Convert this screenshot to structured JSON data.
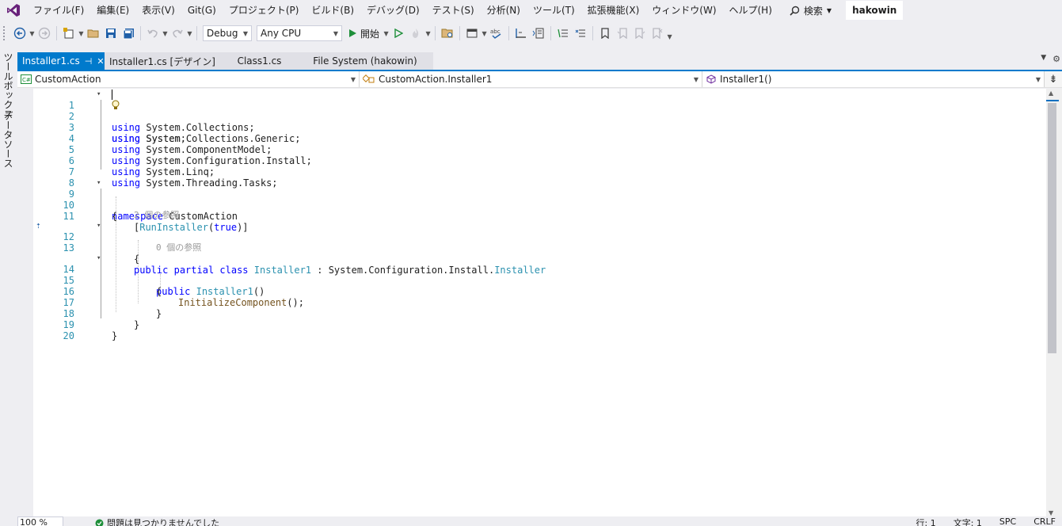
{
  "menu": {
    "logo": "visual-studio-logo",
    "items": [
      "ファイル(F)",
      "編集(E)",
      "表示(V)",
      "Git(G)",
      "プロジェクト(P)",
      "ビルド(B)",
      "デバッグ(D)",
      "テスト(S)",
      "分析(N)",
      "ツール(T)",
      "拡張機能(X)",
      "ウィンドウ(W)",
      "ヘルプ(H)"
    ],
    "search_label": "検索",
    "solution_name": "hakowin"
  },
  "toolbar": {
    "configuration": "Debug",
    "platform": "Any CPU",
    "start_label": "開始"
  },
  "side_tabs": [
    "ツールボックス",
    "データソース"
  ],
  "doc_tabs": [
    {
      "label": "Installer1.cs",
      "active": true
    },
    {
      "label": "Installer1.cs [デザイン]",
      "active": false
    },
    {
      "label": "Class1.cs",
      "active": false
    },
    {
      "label": "File System (hakowin)",
      "active": false
    }
  ],
  "navbar": {
    "project": "CustomAction",
    "type": "CustomAction.Installer1",
    "member": "Installer1()"
  },
  "code_lines": [
    {
      "n": "1"
    },
    {
      "n": "2"
    },
    {
      "n": "3"
    },
    {
      "n": "4"
    },
    {
      "n": "5"
    },
    {
      "n": "6"
    },
    {
      "n": "7"
    },
    {
      "n": "8"
    },
    {
      "n": "9"
    },
    {
      "n": "10"
    },
    {
      "n": "11"
    },
    {
      "n": "12"
    },
    {
      "n": "13"
    },
    {
      "n": "14"
    },
    {
      "n": "15"
    },
    {
      "n": "16"
    },
    {
      "n": "17"
    },
    {
      "n": "18"
    },
    {
      "n": "19"
    },
    {
      "n": "20"
    }
  ],
  "code": {
    "l1": {
      "kw": "using",
      "rest": " System;"
    },
    "l2": {
      "kw": "using",
      "rest": " System.Collections;"
    },
    "l3": {
      "kw": "using",
      "rest": " System.Collections.Generic;"
    },
    "l4": {
      "kw": "using",
      "rest": " System.ComponentModel;"
    },
    "l5": {
      "kw": "using",
      "rest": " System.Configuration.Install;"
    },
    "l6": {
      "kw": "using",
      "rest": " System.Linq;"
    },
    "l7": {
      "kw": "using",
      "rest": " System.Threading.Tasks;"
    },
    "l9": {
      "kw": "namespace",
      "rest": " CustomAction"
    },
    "l10": "{",
    "l11": {
      "open": "[",
      "attr": "RunInstaller",
      "paren": "(",
      "kw": "true",
      "close": ")]"
    },
    "lens1": "2 個の参照",
    "l12": {
      "kw1": "public",
      "kw2": "partial",
      "kw3": "class",
      "cls": "Installer1",
      "sep": " : System.Configuration.Install.",
      "base": "Installer"
    },
    "l13": "{",
    "lens2": "0 個の参照",
    "l14": {
      "kw": "public",
      "name": "Installer1",
      "rest": "()"
    },
    "l15": "{",
    "l16": {
      "method": "InitializeComponent",
      "rest": "();"
    },
    "l17": "}",
    "l18": "}",
    "l19": "}"
  },
  "status": {
    "zoom": "100 %",
    "issues": "問題は見つかりませんでした",
    "line": "行: 1",
    "char": "文字: 1",
    "spc": "SPC",
    "eol": "CRLF"
  },
  "colors": {
    "accent": "#007acc",
    "keyword": "#0000ff",
    "type": "#2b91af",
    "method": "#74531f",
    "lens": "#9a9a9a",
    "ok": "#1e8f3a"
  }
}
